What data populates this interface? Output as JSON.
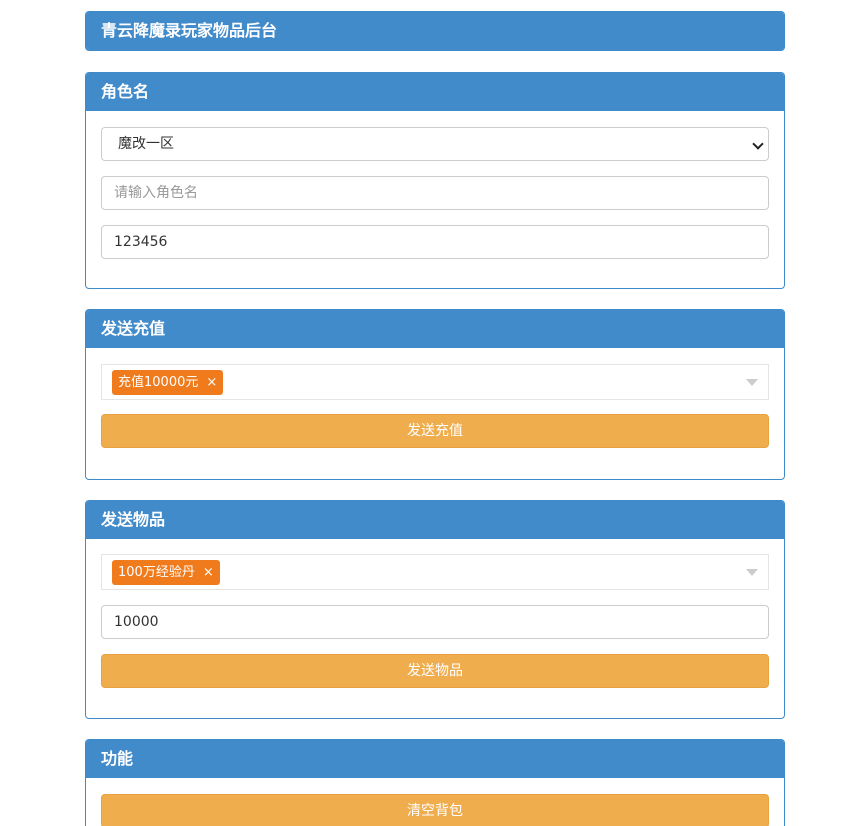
{
  "title_panel": {
    "title": "青云降魔录玩家物品后台"
  },
  "role_panel": {
    "title": "角色名",
    "server_select": {
      "selected": "魔改一区"
    },
    "role_name_input": {
      "value": "",
      "placeholder": "请输入角色名"
    },
    "password_input": {
      "value": "123456"
    }
  },
  "recharge_panel": {
    "title": "发送充值",
    "selected_tag": "充值10000元",
    "tag_remove": "×",
    "button": "发送充值"
  },
  "item_panel": {
    "title": "发送物品",
    "selected_tag": "100万经验丹",
    "tag_remove": "×",
    "quantity": "10000",
    "button": "发送物品"
  },
  "function_panel": {
    "title": "功能",
    "button": "清空背包"
  },
  "colors": {
    "header_blue": "#428bca",
    "button_orange": "#f0ad4e",
    "tag_orange": "#f07b1d"
  }
}
